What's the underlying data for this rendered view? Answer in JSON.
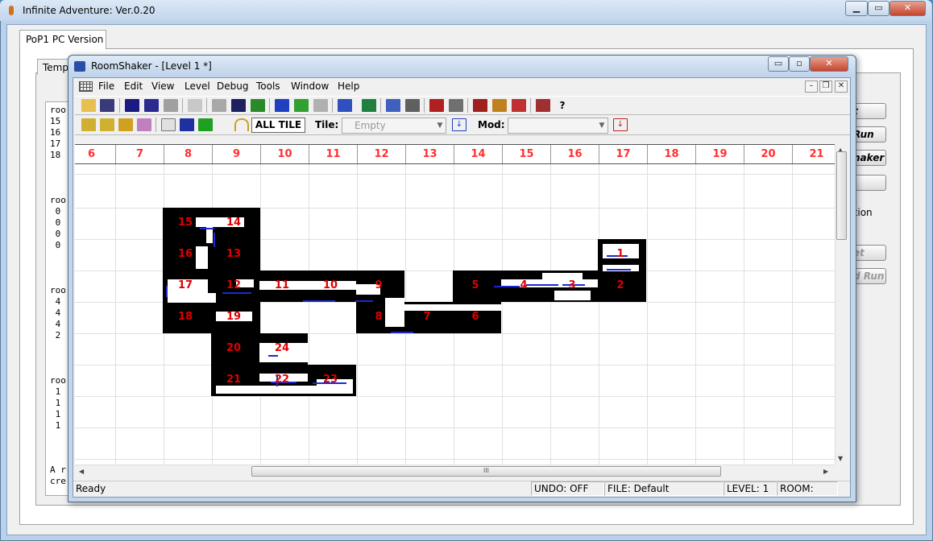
{
  "outer_window": {
    "title": "Infinite Adventure: Ver.0.20",
    "buttons": [
      "▁",
      "▭",
      "✕"
    ],
    "tab_active": "PoP1 PC Version",
    "tab_inner": "Templ",
    "log_lines": [
      "roo",
      "15",
      "16",
      "17",
      "18",
      "",
      "",
      "",
      "roo",
      " 0",
      " 0",
      " 0",
      " 0",
      "",
      "",
      "",
      "roo",
      " 4",
      " 4",
      " 4",
      " 2",
      "",
      "",
      "",
      "roo",
      " 1",
      " 1",
      " 1",
      " 1"
    ],
    "log_footer": [
      "A r",
      "cre"
    ],
    "right_buttons": [
      {
        "label": "t",
        "disabled": false
      },
      {
        "label": "Run",
        "disabled": false
      },
      {
        "label": "haker",
        "disabled": false
      },
      {
        "label": "",
        "disabled": false
      },
      {
        "label": "et",
        "disabled": true
      },
      {
        "label": "d Run",
        "disabled": true
      }
    ],
    "right_label": "eration"
  },
  "roomshaker": {
    "title": "RoomShaker - [Level 1 *]",
    "title_buttons": [
      "▭",
      "▫",
      "✕"
    ],
    "menu": [
      "File",
      "Edit",
      "View",
      "Level",
      "Debug",
      "Tools",
      "Window",
      "Help"
    ],
    "mdi_buttons": [
      "–",
      "❐",
      "✕"
    ],
    "all_tile_label": "ALL TILE",
    "tile_label": "Tile:",
    "tile_value": "Empty",
    "mod_label": "Mod:",
    "mod_value": "",
    "ruler_columns": [
      "6",
      "7",
      "8",
      "9",
      "10",
      "11",
      "12",
      "13",
      "14",
      "15",
      "16",
      "17",
      "18",
      "19",
      "20",
      "21"
    ],
    "rooms": [
      "15",
      "14",
      "16",
      "13",
      "17",
      "12",
      "11",
      "10",
      "9",
      "5",
      "4",
      "3",
      "2",
      "1",
      "18",
      "19",
      "8",
      "7",
      "6",
      "20",
      "24",
      "21",
      "22",
      "23"
    ],
    "scroll_glyph": "III",
    "status": {
      "ready": "Ready",
      "undo": "UNDO: OFF",
      "file": "FILE: Default",
      "level": "LEVEL: 1",
      "room": "ROOM:"
    }
  },
  "colors": {
    "room_number": "#e00000",
    "ruler_number": "#ff3030",
    "wall": "#000000",
    "guard_marker": "#1a2ad0"
  }
}
